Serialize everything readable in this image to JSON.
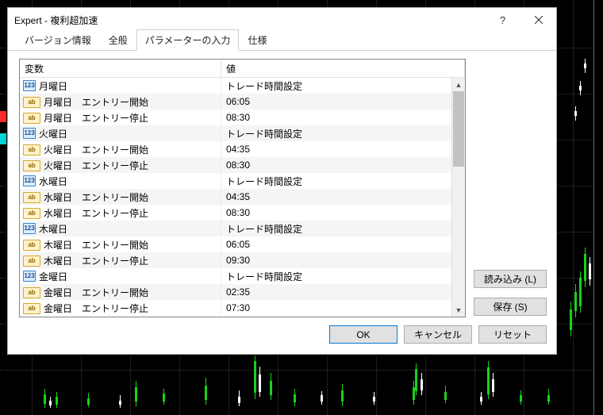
{
  "window": {
    "title": "Expert - 複利超加速"
  },
  "tabs": [
    {
      "label": "バージョン情報",
      "active": false
    },
    {
      "label": "全般",
      "active": false
    },
    {
      "label": "パラメーターの入力",
      "active": true
    },
    {
      "label": "仕様",
      "active": false
    }
  ],
  "table": {
    "header_name": "変数",
    "header_value": "値",
    "rows": [
      {
        "icon": "123",
        "name": "月曜日",
        "value": "トレード時間設定"
      },
      {
        "icon": "ab",
        "name": "月曜日　エントリー開始",
        "value": "06:05"
      },
      {
        "icon": "ab",
        "name": "月曜日　エントリー停止",
        "value": "08:30"
      },
      {
        "icon": "123",
        "name": "火曜日",
        "value": "トレード時間設定"
      },
      {
        "icon": "ab",
        "name": "火曜日　エントリー開始",
        "value": "04:35"
      },
      {
        "icon": "ab",
        "name": "火曜日　エントリー停止",
        "value": "08:30"
      },
      {
        "icon": "123",
        "name": "水曜日",
        "value": "トレード時間設定"
      },
      {
        "icon": "ab",
        "name": "水曜日　エントリー開始",
        "value": "04:35"
      },
      {
        "icon": "ab",
        "name": "水曜日　エントリー停止",
        "value": "08:30"
      },
      {
        "icon": "123",
        "name": "木曜日",
        "value": "トレード時間設定"
      },
      {
        "icon": "ab",
        "name": "木曜日　エントリー開始",
        "value": "06:05"
      },
      {
        "icon": "ab",
        "name": "木曜日　エントリー停止",
        "value": "09:30"
      },
      {
        "icon": "123",
        "name": "金曜日",
        "value": "トレード時間設定"
      },
      {
        "icon": "ab",
        "name": "金曜日　エントリー開始",
        "value": "02:35"
      },
      {
        "icon": "ab",
        "name": "金曜日　エントリー停止",
        "value": "07:30"
      }
    ]
  },
  "side_buttons": {
    "load": "読み込み (L)",
    "save": "保存 (S)"
  },
  "footer": {
    "ok": "OK",
    "cancel": "キャンセル",
    "reset": "リセット"
  }
}
